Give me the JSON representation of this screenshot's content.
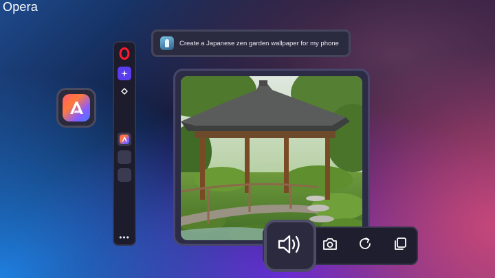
{
  "brand": {
    "name": "Opera"
  },
  "prompt": {
    "text": "Create a Japanese zen garden  wallpaper for my phone",
    "avatar_icon": "user-avatar-icon"
  },
  "app_icon": {
    "icon": "aria-logo-icon"
  },
  "sidebar": {
    "items": [
      {
        "name": "opera-logo-icon"
      },
      {
        "name": "aria-sparkle-icon"
      },
      {
        "name": "diamond-icon"
      },
      {
        "name": "aria-app-icon"
      },
      {
        "name": "empty-slot"
      },
      {
        "name": "empty-slot"
      }
    ],
    "more_label": "•••"
  },
  "image_card": {
    "description_icon": "generated-image",
    "subject": "zen-garden"
  },
  "actions": [
    {
      "name": "speaker-icon"
    },
    {
      "name": "camera-icon"
    },
    {
      "name": "refresh-icon"
    },
    {
      "name": "copy-icon"
    }
  ],
  "colors": {
    "accent": "#5b3df0",
    "opera_red": "#ff1b2d",
    "panel": "#1c1c2c"
  }
}
